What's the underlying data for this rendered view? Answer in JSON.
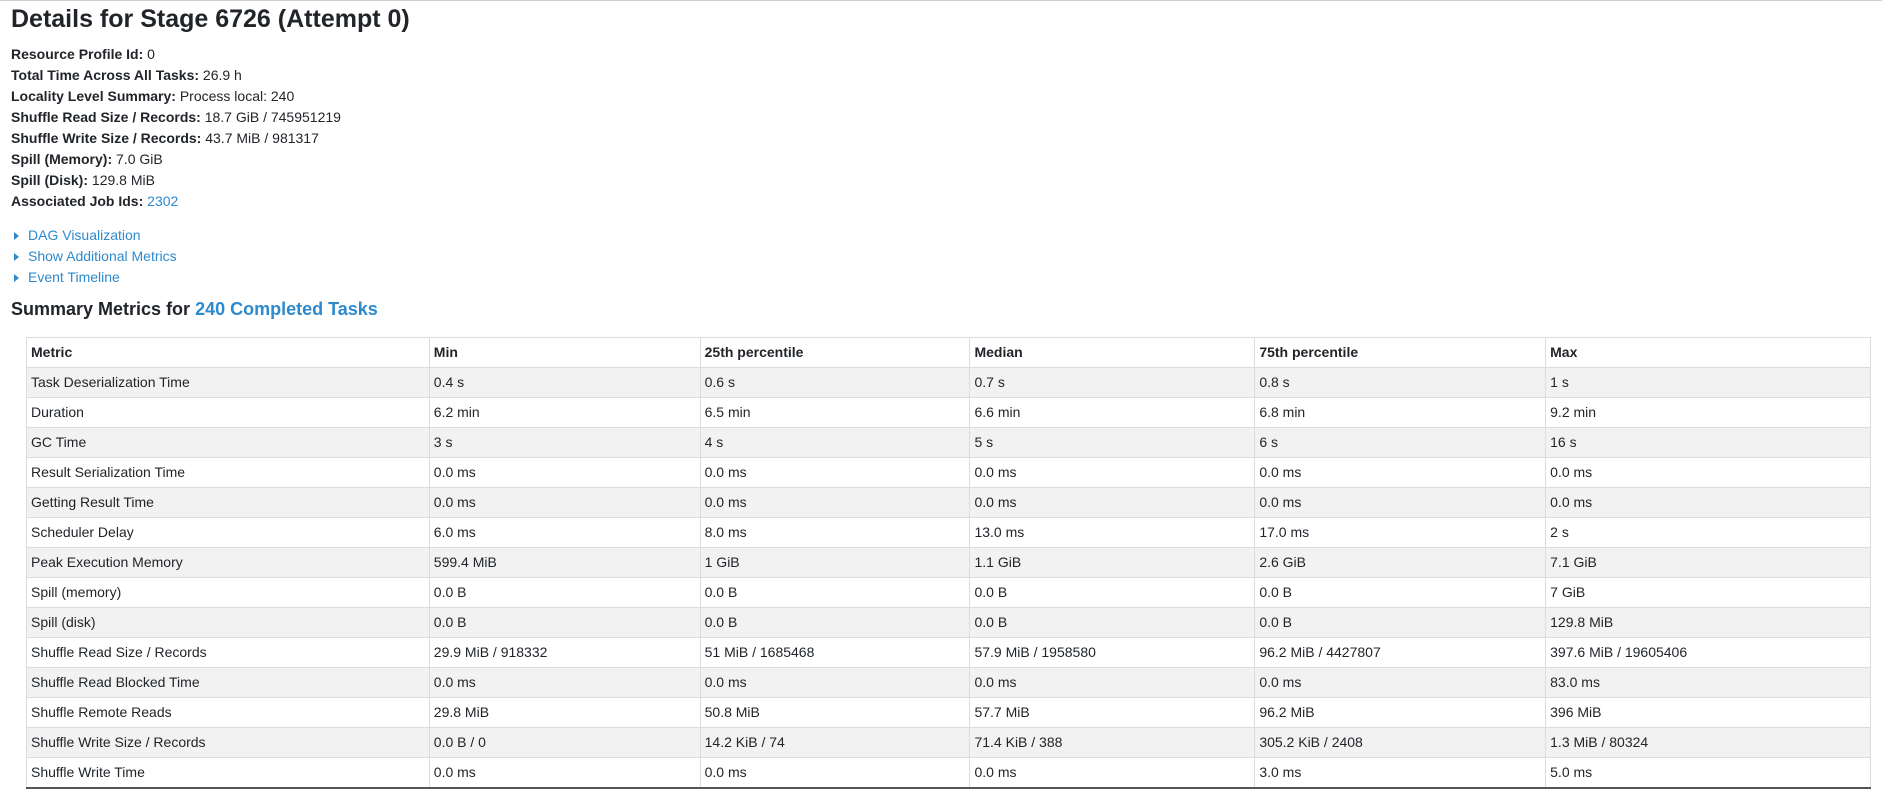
{
  "page": {
    "title": "Details for Stage 6726 (Attempt 0)"
  },
  "summary": [
    {
      "label": "Resource Profile Id:",
      "value": "0"
    },
    {
      "label": "Total Time Across All Tasks:",
      "value": "26.9 h"
    },
    {
      "label": "Locality Level Summary:",
      "value": "Process local: 240"
    },
    {
      "label": "Shuffle Read Size / Records:",
      "value": "18.7 GiB / 745951219"
    },
    {
      "label": "Shuffle Write Size / Records:",
      "value": "43.7 MiB / 981317"
    },
    {
      "label": "Spill (Memory):",
      "value": "7.0 GiB"
    },
    {
      "label": "Spill (Disk):",
      "value": "129.8 MiB"
    },
    {
      "label": "Associated Job Ids:",
      "value": "2302"
    }
  ],
  "expanders": [
    {
      "label": "DAG Visualization"
    },
    {
      "label": "Show Additional Metrics"
    },
    {
      "label": "Event Timeline"
    }
  ],
  "metrics_section": {
    "heading_prefix": "Summary Metrics for ",
    "heading_link": "240 Completed Tasks"
  },
  "table": {
    "headers": [
      "Metric",
      "Min",
      "25th percentile",
      "Median",
      "75th percentile",
      "Max"
    ],
    "rows": [
      [
        "Task Deserialization Time",
        "0.4 s",
        "0.6 s",
        "0.7 s",
        "0.8 s",
        "1 s"
      ],
      [
        "Duration",
        "6.2 min",
        "6.5 min",
        "6.6 min",
        "6.8 min",
        "9.2 min"
      ],
      [
        "GC Time",
        "3 s",
        "4 s",
        "5 s",
        "6 s",
        "16 s"
      ],
      [
        "Result Serialization Time",
        "0.0 ms",
        "0.0 ms",
        "0.0 ms",
        "0.0 ms",
        "0.0 ms"
      ],
      [
        "Getting Result Time",
        "0.0 ms",
        "0.0 ms",
        "0.0 ms",
        "0.0 ms",
        "0.0 ms"
      ],
      [
        "Scheduler Delay",
        "6.0 ms",
        "8.0 ms",
        "13.0 ms",
        "17.0 ms",
        "2 s"
      ],
      [
        "Peak Execution Memory",
        "599.4 MiB",
        "1 GiB",
        "1.1 GiB",
        "2.6 GiB",
        "7.1 GiB"
      ],
      [
        "Spill (memory)",
        "0.0 B",
        "0.0 B",
        "0.0 B",
        "0.0 B",
        "7 GiB"
      ],
      [
        "Spill (disk)",
        "0.0 B",
        "0.0 B",
        "0.0 B",
        "0.0 B",
        "129.8 MiB"
      ],
      [
        "Shuffle Read Size / Records",
        "29.9 MiB / 918332",
        "51 MiB / 1685468",
        "57.9 MiB / 1958580",
        "96.2 MiB / 4427807",
        "397.6 MiB / 19605406"
      ],
      [
        "Shuffle Read Blocked Time",
        "0.0 ms",
        "0.0 ms",
        "0.0 ms",
        "0.0 ms",
        "83.0 ms"
      ],
      [
        "Shuffle Remote Reads",
        "29.8 MiB",
        "50.8 MiB",
        "57.7 MiB",
        "96.2 MiB",
        "396 MiB"
      ],
      [
        "Shuffle Write Size / Records",
        "0.0 B / 0",
        "14.2 KiB / 74",
        "71.4 KiB / 388",
        "305.2 KiB / 2408",
        "1.3 MiB / 80324"
      ],
      [
        "Shuffle Write Time",
        "0.0 ms",
        "0.0 ms",
        "0.0 ms",
        "3.0 ms",
        "5.0 ms"
      ]
    ]
  },
  "colors": {
    "link": "#2d8acd",
    "text": "#212529",
    "stripe": "#f2f2f2"
  }
}
